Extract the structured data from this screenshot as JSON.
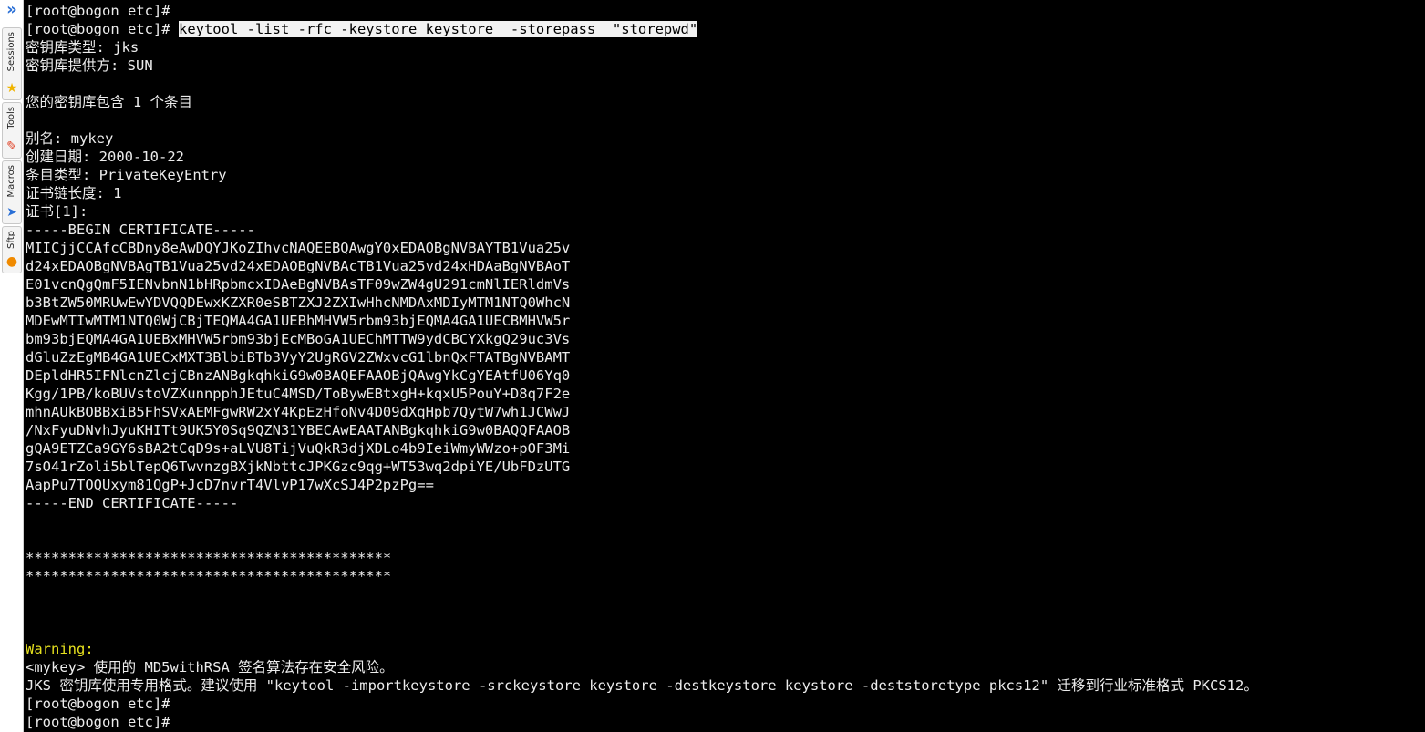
{
  "colors": {
    "terminal_bg": "#000000",
    "terminal_fg": "#ececec",
    "warning_fg": "#e6e11e",
    "selection_bg": "#f2f2f2",
    "dock_accent": "#2a6fd6"
  },
  "side_dock": {
    "toggle_icon": "double-chevron-right-icon",
    "tabs": [
      {
        "label": "Sessions",
        "icon": "star-icon"
      },
      {
        "label": "Tools",
        "icon": "tools-icon"
      },
      {
        "label": "Macros",
        "icon": "paper-plane-icon"
      },
      {
        "label": "Sftp",
        "icon": "sftp-icon"
      }
    ]
  },
  "terminal": {
    "lines": [
      {
        "text": "[root@bogon etc]#"
      },
      {
        "prompt": "[root@bogon etc]# ",
        "command": "keytool -list -rfc -keystore keystore  -storepass  \"storepwd\""
      },
      {
        "text": "密钥库类型: jks"
      },
      {
        "text": "密钥库提供方: SUN"
      },
      {
        "text": ""
      },
      {
        "text": "您的密钥库包含 1 个条目"
      },
      {
        "text": ""
      },
      {
        "text": "别名: mykey"
      },
      {
        "text": "创建日期: 2000-10-22"
      },
      {
        "text": "条目类型: PrivateKeyEntry"
      },
      {
        "text": "证书链长度: 1"
      },
      {
        "text": "证书[1]:"
      },
      {
        "text": "-----BEGIN CERTIFICATE-----"
      },
      {
        "text": "MIICjjCCAfcCBDny8eAwDQYJKoZIhvcNAQEEBQAwgY0xEDAOBgNVBAYTB1Vua25v"
      },
      {
        "text": "d24xEDAOBgNVBAgTB1Vua25vd24xEDAOBgNVBAcTB1Vua25vd24xHDAaBgNVBAoT"
      },
      {
        "text": "E01vcnQgQmF5IENvbnN1bHRpbmcxIDAeBgNVBAsTF09wZW4gU291cmNlIERldmVs"
      },
      {
        "text": "b3BtZW50MRUwEwYDVQQDEwxKZXR0eSBTZXJ2ZXIwHhcNMDAxMDIyMTM1NTQ0WhcN"
      },
      {
        "text": "MDEwMTIwMTM1NTQ0WjCBjTEQMA4GA1UEBhMHVW5rbm93bjEQMA4GA1UECBMHVW5r"
      },
      {
        "text": "bm93bjEQMA4GA1UEBxMHVW5rbm93bjEcMBoGA1UEChMTTW9ydCBCYXkgQ29uc3Vs"
      },
      {
        "text": "dGluZzEgMB4GA1UECxMXT3BlbiBTb3VyY2UgRGV2ZWxvcG1lbnQxFTATBgNVBAMT"
      },
      {
        "text": "DEpldHR5IFNlcnZlcjCBnzANBgkqhkiG9w0BAQEFAAOBjQAwgYkCgYEAtfU06Yq0"
      },
      {
        "text": "Kgg/1PB/koBUVstoVZXunnpphJEtuC4MSD/ToBywEBtxgH+kqxU5PouY+D8q7F2e"
      },
      {
        "text": "mhnAUkBOBBxiB5FhSVxAEMFgwRW2xY4KpEzHfoNv4D09dXqHpb7QytW7wh1JCWwJ"
      },
      {
        "text": "/NxFyuDNvhJyuKHITt9UK5Y0Sq9QZN31YBECAwEAATANBgkqhkiG9w0BAQQFAAOB"
      },
      {
        "text": "gQA9ETZCa9GY6sBA2tCqD9s+aLVU8TijVuQkR3djXDLo4b9IeiWmyWWzo+pOF3Mi"
      },
      {
        "text": "7sO41rZoli5blTepQ6TwvnzgBXjkNbttcJPKGzc9qg+WT53wq2dpiYE/UbFDzUTG"
      },
      {
        "text": "AapPu7TOQUxym81QgP+JcD7nvrT4VlvP17wXcSJ4P2pzPg=="
      },
      {
        "text": "-----END CERTIFICATE-----"
      },
      {
        "text": ""
      },
      {
        "text": ""
      },
      {
        "text": "*******************************************"
      },
      {
        "text": "*******************************************"
      },
      {
        "text": ""
      },
      {
        "text": ""
      },
      {
        "text": ""
      },
      {
        "text": "Warning:",
        "style": "warn"
      },
      {
        "text": "<mykey> 使用的 MD5withRSA 签名算法存在安全风险。"
      },
      {
        "text": "JKS 密钥库使用专用格式。建议使用 \"keytool -importkeystore -srckeystore keystore -destkeystore keystore -deststoretype pkcs12\" 迁移到行业标准格式 PKCS12。"
      },
      {
        "text": "[root@bogon etc]#"
      },
      {
        "text": "[root@bogon etc]#"
      }
    ]
  }
}
